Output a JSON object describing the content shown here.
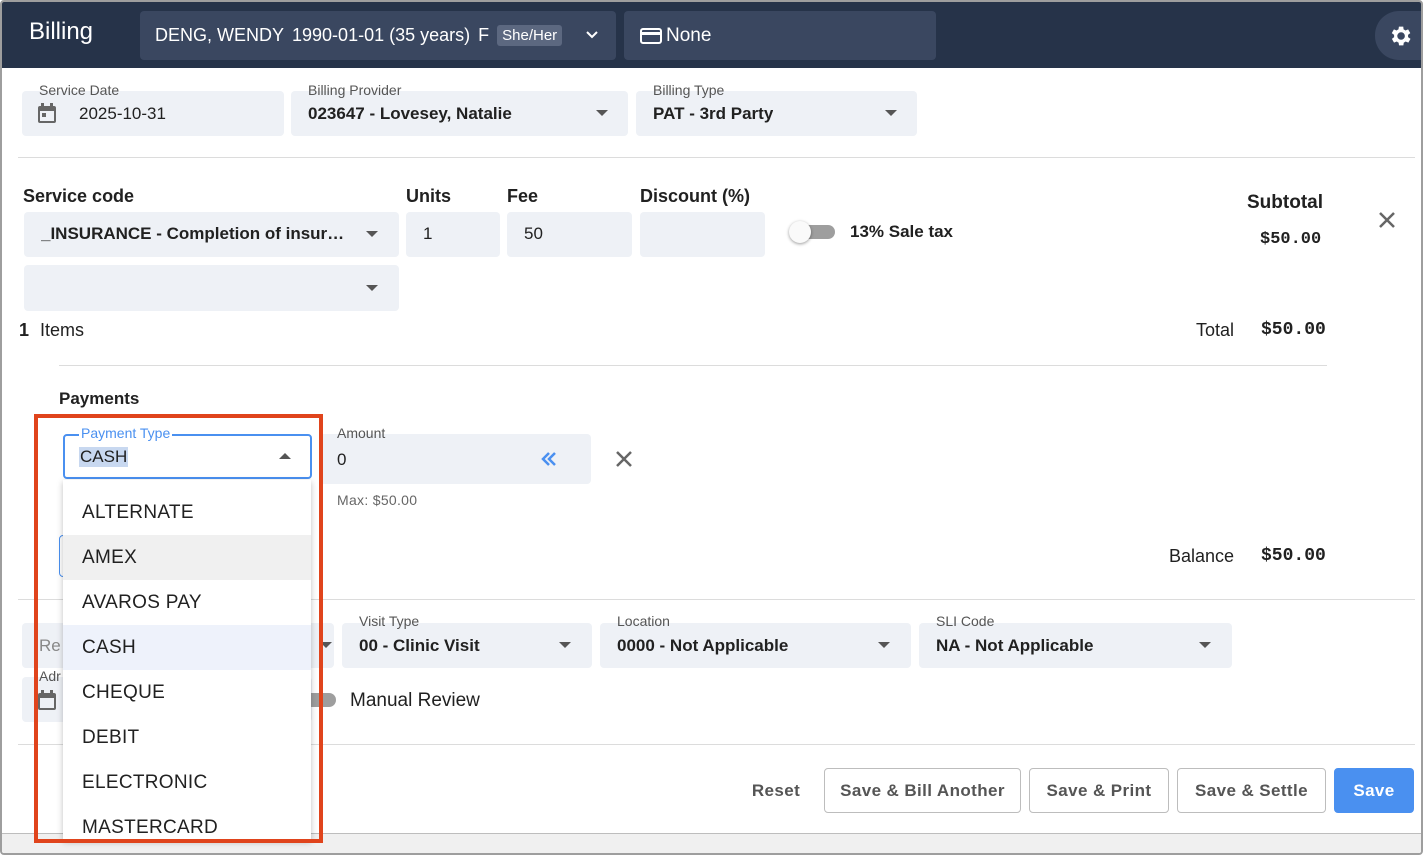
{
  "header": {
    "title": "Billing",
    "patient_name": "DENG, WENDY",
    "patient_dob": "1990-01-01 (35 years)",
    "patient_sex": "F",
    "patient_pronoun": "She/Her",
    "insurance_card": "None"
  },
  "billing": {
    "service_date_label": "Service Date",
    "service_date": "2025-10-31",
    "provider_label": "Billing Provider",
    "provider": "023647 - Lovesey, Natalie",
    "type_label": "Billing Type",
    "type": "PAT - 3rd Party"
  },
  "items": {
    "service_code_header": "Service code",
    "units_header": "Units",
    "fee_header": "Fee",
    "discount_header": "Discount (%)",
    "subtotal_header": "Subtotal",
    "service_code": "_INSURANCE - Completion of insurance form",
    "units": "1",
    "fee": "50",
    "discount": "",
    "sale_tax_label": "13% Sale tax",
    "subtotal": "$50.00",
    "count": "1",
    "count_label": "Items",
    "total_label": "Total",
    "total": "$50.00"
  },
  "payments": {
    "heading": "Payments",
    "payment_type_label": "Payment Type",
    "payment_type": "CASH",
    "amount_label": "Amount",
    "amount": "0",
    "max_hint": "Max: $50.00",
    "balance_label": "Balance",
    "balance": "$50.00",
    "options": [
      "ALTERNATE",
      "AMEX",
      "AVAROS PAY",
      "CASH",
      "CHEQUE",
      "DEBIT",
      "ELECTRONIC",
      "MASTERCARD"
    ],
    "hovered_option": "AMEX",
    "selected_option": "CASH"
  },
  "visit": {
    "referral_partial": "Re",
    "admission_partial": "Adr",
    "visit_type_label": "Visit Type",
    "visit_type": "00 - Clinic Visit",
    "location_label": "Location",
    "location": "0000 - Not Applicable",
    "sli_label": "SLI Code",
    "sli": "NA - Not Applicable",
    "manual_review_label": "Manual Review"
  },
  "actions": {
    "reset": "Reset",
    "save_bill_another": "Save & Bill Another",
    "save_print": "Save & Print",
    "save_settle": "Save & Settle",
    "save": "Save"
  },
  "colors": {
    "header_bg": "#263349",
    "field_bg": "#eef1f6",
    "primary": "#4a90f0",
    "highlight": "#e0441c"
  }
}
